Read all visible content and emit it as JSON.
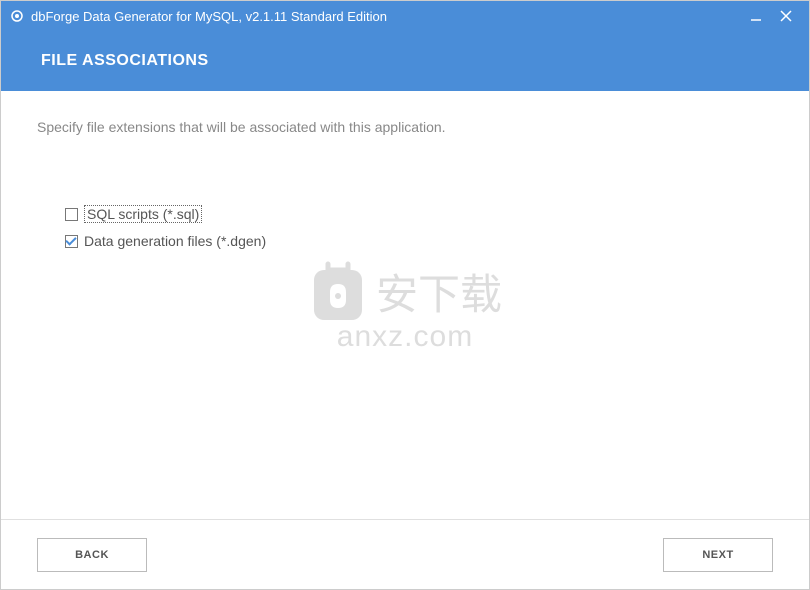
{
  "titlebar": {
    "title": "dbForge Data Generator for MySQL, v2.1.11 Standard Edition"
  },
  "header": {
    "title": "FILE ASSOCIATIONS"
  },
  "content": {
    "instruction": "Specify file extensions that will be associated with this application.",
    "options": [
      {
        "label": "SQL scripts (*.sql)",
        "checked": false,
        "focused": true
      },
      {
        "label": "Data generation files (*.dgen)",
        "checked": true,
        "focused": false
      }
    ]
  },
  "watermark": {
    "main": "安下载",
    "sub": "anxz.com"
  },
  "footer": {
    "back_label": "BACK",
    "next_label": "NEXT"
  }
}
